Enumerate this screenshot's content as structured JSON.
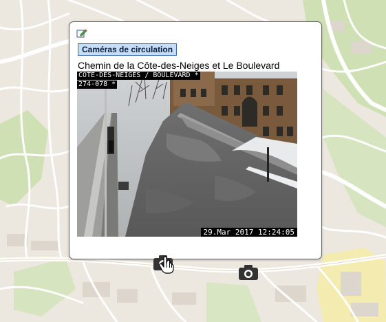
{
  "popup": {
    "edit_icon": "edit-pencil-icon",
    "layer_label": "Caméras de circulation",
    "camera_title": "Chemin de la Côte-des-Neiges et Le Boulevard",
    "feed": {
      "name_overlay": "COTE-DES-NEIGES / BOULEVARD *",
      "id_overlay": "274-078 *",
      "timestamp": "29.Mar 2017   12:24:05"
    }
  },
  "map": {
    "markers": [
      {
        "icon": "camera-icon",
        "active": true
      },
      {
        "icon": "camera-icon",
        "active": false
      }
    ],
    "cursor": "hand-pointer-icon",
    "colors": {
      "land": "#ece7df",
      "park": "#cfe0b4",
      "road": "#ffffff",
      "building": "#ddd6cc",
      "highlight": "#f3ebb0"
    }
  },
  "colors": {
    "badge_bg": "#c7dcf5",
    "badge_border": "#3a6db3",
    "marker": "#333333"
  }
}
